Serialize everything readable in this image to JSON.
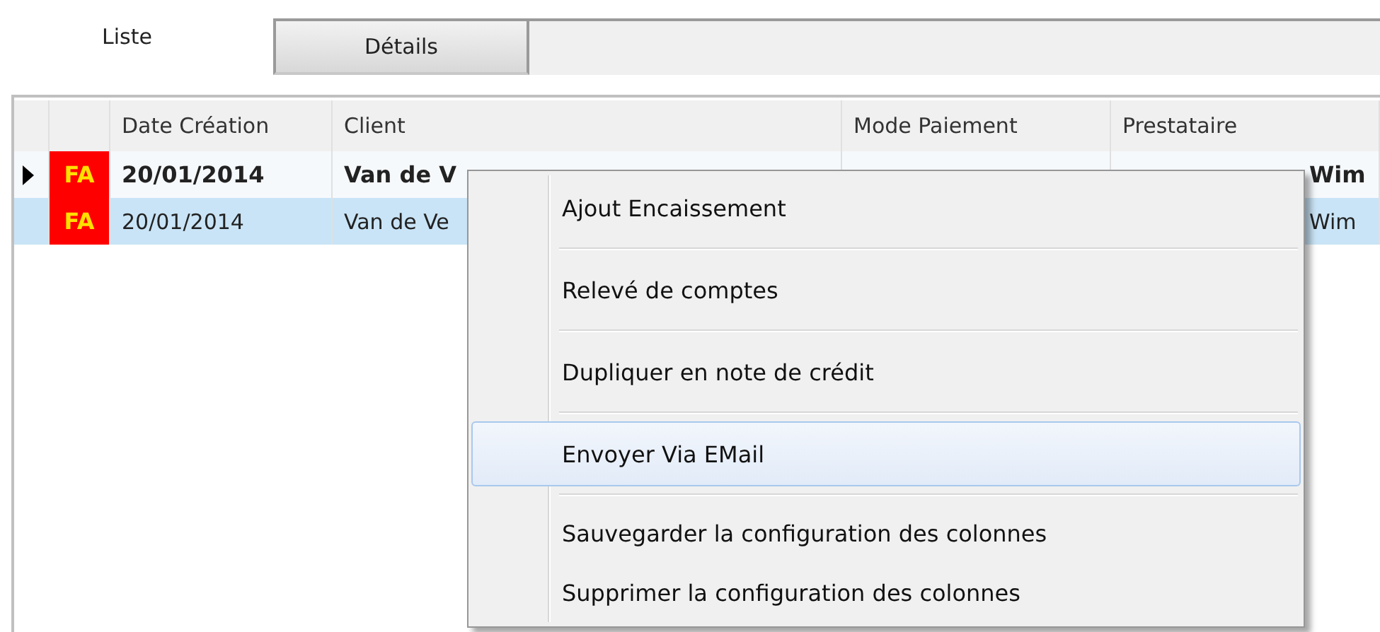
{
  "tabs": [
    {
      "label": "Liste",
      "selected": true
    },
    {
      "label": "Détails",
      "selected": false
    }
  ],
  "table": {
    "columns": [
      "Date Création",
      "Client",
      "Mode Paiement",
      "Prestataire"
    ],
    "rows": [
      {
        "current": true,
        "selected": false,
        "type": "FA",
        "date": "20/01/2014",
        "client": "Van de V",
        "provider": "Wim"
      },
      {
        "current": false,
        "selected": true,
        "type": "FA",
        "date": "20/01/2014",
        "client": "Van de Ve",
        "provider": "Wim"
      }
    ]
  },
  "context_menu": {
    "items": [
      {
        "label": "Ajout Encaissement",
        "highlighted": false,
        "separator_after": true
      },
      {
        "label": "Relevé de comptes",
        "highlighted": false,
        "separator_after": true
      },
      {
        "label": "Dupliquer en note de crédit",
        "highlighted": false,
        "separator_after": true
      },
      {
        "label": "Envoyer Via EMail",
        "highlighted": true,
        "separator_after": true
      },
      {
        "label": "Sauvegarder la configuration des colonnes",
        "highlighted": false,
        "separator_after": false
      },
      {
        "label": "Supprimer la configuration des colonnes",
        "highlighted": false,
        "separator_after": false
      }
    ]
  }
}
